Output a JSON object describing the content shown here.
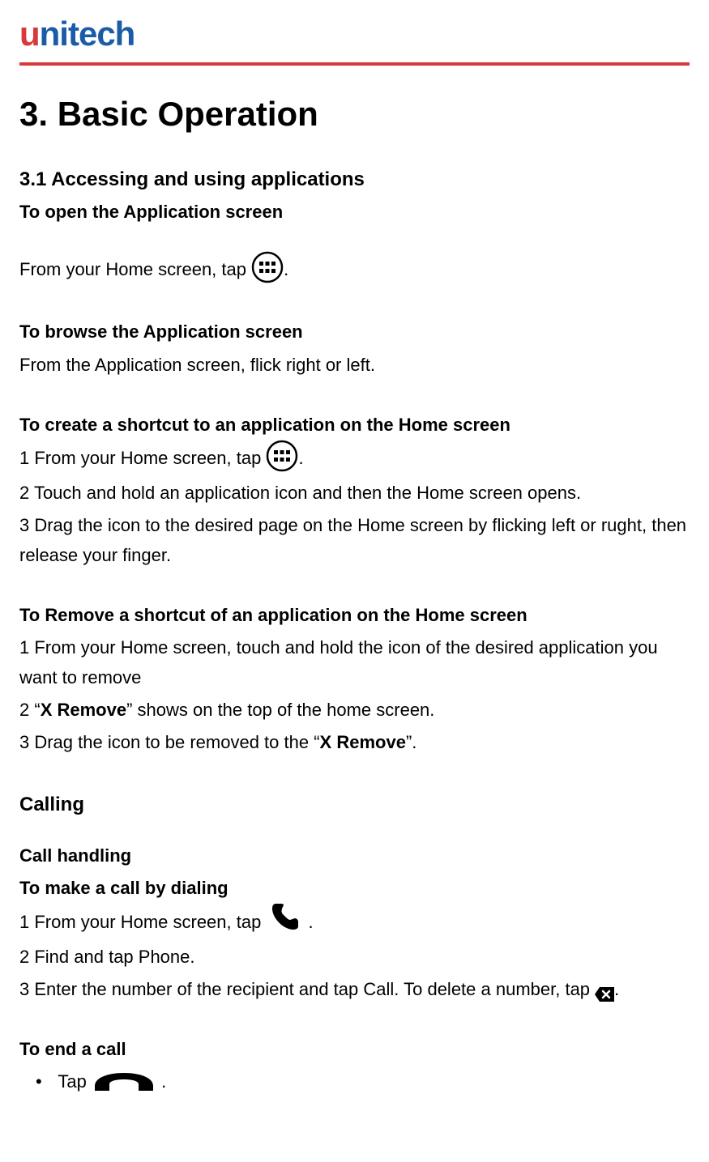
{
  "logo": {
    "first": "u",
    "rest": "nitech"
  },
  "title": "3. Basic Operation",
  "section_3_1": {
    "heading": "3.1 Accessing and using applications",
    "open_screen": {
      "head": "To open the Application screen",
      "line1_a": "From your Home screen, tap",
      "line1_b": "."
    },
    "browse": {
      "head": "To browse the Application screen",
      "body": "From the Application screen, flick right or left."
    },
    "create_shortcut": {
      "head": "To create a shortcut to an application on the Home screen",
      "step1_a": "1 From your Home screen, tap ",
      "step1_b": ".",
      "step2": "2 Touch and hold an application icon and then the Home screen opens.",
      "step3": "3 Drag the icon to the desired page on the Home screen by flicking left or rught, then release your finger."
    },
    "remove_shortcut": {
      "head": "To Remove a shortcut of an application on the Home screen",
      "step1": "1 From your Home screen, touch and hold the icon of the desired application you want to remove",
      "step2_a": "2 “",
      "step2_bold": "X Remove",
      "step2_b": "” shows on the top of the home screen.",
      "step3_a": "3 Drag the icon to be removed to the “",
      "step3_bold": "X Remove",
      "step3_b": "”."
    }
  },
  "calling": {
    "heading": "Calling",
    "handling_head": "Call handling",
    "make_call": {
      "head": "To make a call by dialing",
      "step1_a": "1 From your Home screen, tap ",
      "step1_b": ".",
      "step2": "2 Find and tap Phone.",
      "step3_a": "3 Enter the number of the recipient and tap Call. To delete a number, tap ",
      "step3_b": "."
    },
    "end_call": {
      "head": "To end a call",
      "tap_a": "Tap ",
      "tap_b": " ."
    }
  }
}
